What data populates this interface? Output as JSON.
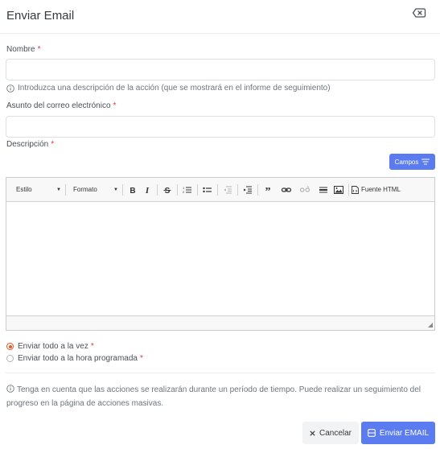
{
  "dialog": {
    "title": "Enviar Email"
  },
  "form": {
    "name_label": "Nombre",
    "name_value": "",
    "name_help": "Introduzca una descripción de la acción (que se mostrará en el informe de seguimiento)",
    "subject_label": "Asunto del correo electrónico",
    "subject_value": "",
    "description_label": "Descripción",
    "required_mark": "*",
    "fields_button_label": "Campos"
  },
  "editor": {
    "style_combo": "Estilo",
    "format_combo": "Formato",
    "source_label": "Fuente HTML",
    "content": ""
  },
  "schedule": {
    "options": [
      {
        "label": "Enviar todo a la vez",
        "checked": true
      },
      {
        "label": "Enviar todo a la hora programada",
        "checked": false
      }
    ]
  },
  "note": {
    "text": "Tenga en cuenta que las acciones se realizarán durante un período de tiempo. Puede realizar un seguimiento del progreso en la página de acciones masivas."
  },
  "footer": {
    "cancel_label": "Cancelar",
    "send_label": "Enviar EMAIL"
  },
  "colors": {
    "primary": "#5b7bf0",
    "required": "#dc3545",
    "radio_checked": "#e8551f"
  }
}
